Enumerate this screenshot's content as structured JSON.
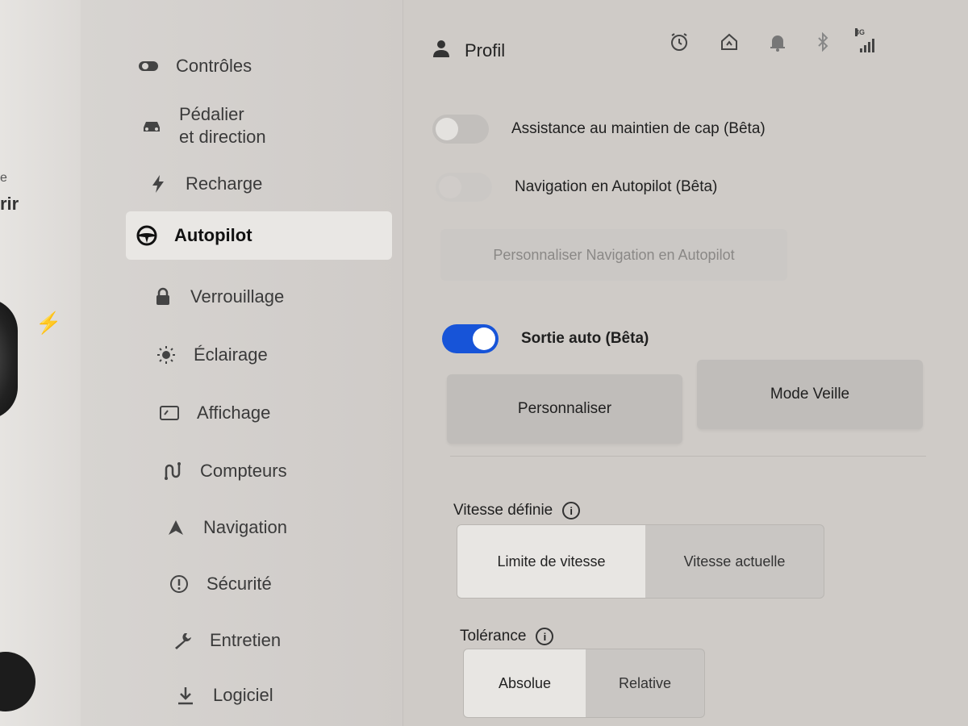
{
  "edge": {
    "fragment_e": "e",
    "fragment_rir": "rir"
  },
  "sidebar": {
    "items": [
      {
        "label": "Contrôles",
        "icon": "toggle-icon"
      },
      {
        "label_line1": "Pédalier",
        "label_line2": "et direction",
        "icon": "car-icon"
      },
      {
        "label": "Recharge",
        "icon": "bolt-icon"
      },
      {
        "label": "Autopilot",
        "icon": "steering-wheel-icon",
        "active": true
      },
      {
        "label": "Verrouillage",
        "icon": "lock-icon"
      },
      {
        "label": "Éclairage",
        "icon": "sun-icon"
      },
      {
        "label": "Affichage",
        "icon": "display-icon"
      },
      {
        "label": "Compteurs",
        "icon": "road-icon"
      },
      {
        "label": "Navigation",
        "icon": "navigation-arrow-icon"
      },
      {
        "label": "Sécurité",
        "icon": "alert-icon"
      },
      {
        "label": "Entretien",
        "icon": "wrench-icon"
      },
      {
        "label": "Logiciel",
        "icon": "download-icon"
      }
    ]
  },
  "header": {
    "profile_label": "Profil",
    "network": "3G"
  },
  "settings": {
    "autosteer_label": "Assistance au maintien de cap (Bêta)",
    "autosteer_on": false,
    "nav_autopilot_label": "Navigation en Autopilot (Bêta)",
    "nav_autopilot_on": false,
    "customize_nav_label": "Personnaliser Navigation en Autopilot",
    "summon_label": "Sortie auto (Bêta)",
    "summon_on": true,
    "customize_button": "Personnaliser",
    "standby_button": "Mode Veille",
    "speed_label": "Vitesse définie",
    "speed_options": [
      "Limite de vitesse",
      "Vitesse actuelle"
    ],
    "speed_selected": "Limite de vitesse",
    "tolerance_label": "Tolérance",
    "tolerance_options": [
      "Absolue",
      "Relative"
    ],
    "tolerance_selected": "Absolue",
    "info_glyph": "i"
  },
  "colors": {
    "accent": "#1754d8",
    "background": "#cfcbc7"
  }
}
